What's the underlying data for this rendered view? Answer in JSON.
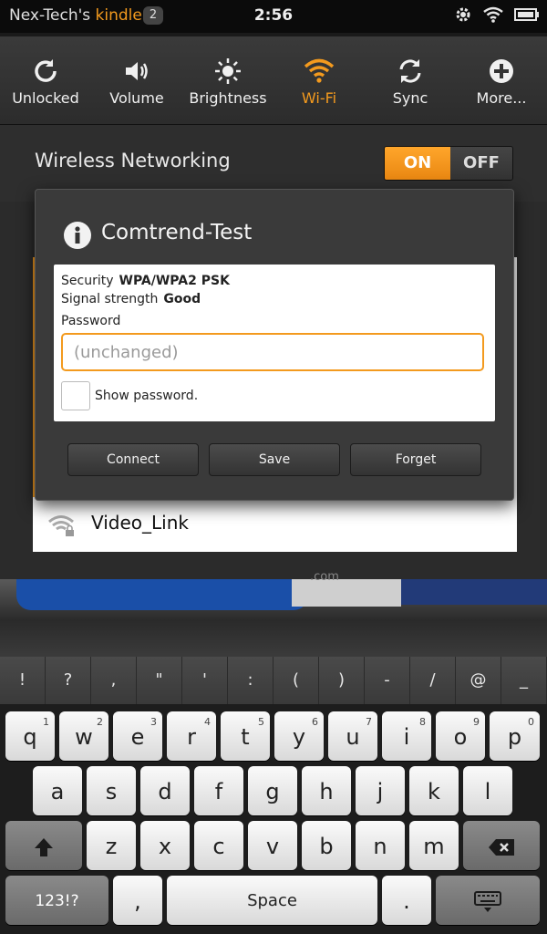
{
  "status": {
    "brand_prefix": "Nex-Tech's ",
    "brand_name": "kindle",
    "notification_count": "2",
    "time": "2:56"
  },
  "quick_settings": [
    {
      "label": "Unlocked",
      "icon": "rotate-lock-icon",
      "active": false
    },
    {
      "label": "Volume",
      "icon": "speaker-icon",
      "active": false
    },
    {
      "label": "Brightness",
      "icon": "sun-icon",
      "active": false
    },
    {
      "label": "Wi-Fi",
      "icon": "wifi-icon",
      "active": true
    },
    {
      "label": "Sync",
      "icon": "sync-icon",
      "active": false
    },
    {
      "label": "More...",
      "icon": "plus-icon",
      "active": false
    }
  ],
  "wireless": {
    "title": "Wireless Networking",
    "on_label": "ON",
    "off_label": "OFF"
  },
  "network_list": {
    "visible_item": "Video_Link"
  },
  "shelf": {
    "book_text": ".com"
  },
  "dialog": {
    "title": "Comtrend-Test",
    "security_label": "Security",
    "security_value": "WPA/WPA2 PSK",
    "signal_label": "Signal strength",
    "signal_value": "Good",
    "password_label": "Password",
    "password_placeholder": "(unchanged)",
    "show_password_label": "Show password.",
    "buttons": {
      "connect": "Connect",
      "save": "Save",
      "forget": "Forget"
    }
  },
  "keyboard": {
    "symbols": [
      "!",
      "?",
      ",",
      "\"",
      "'",
      ":",
      "(",
      ")",
      "-",
      "/",
      "@",
      "_"
    ],
    "row1": [
      {
        "k": "q",
        "n": "1"
      },
      {
        "k": "w",
        "n": "2"
      },
      {
        "k": "e",
        "n": "3"
      },
      {
        "k": "r",
        "n": "4"
      },
      {
        "k": "t",
        "n": "5"
      },
      {
        "k": "y",
        "n": "6"
      },
      {
        "k": "u",
        "n": "7"
      },
      {
        "k": "i",
        "n": "8"
      },
      {
        "k": "o",
        "n": "9"
      },
      {
        "k": "p",
        "n": "0"
      }
    ],
    "row2": [
      "a",
      "s",
      "d",
      "f",
      "g",
      "h",
      "j",
      "k",
      "l"
    ],
    "row3": [
      "z",
      "x",
      "c",
      "v",
      "b",
      "n",
      "m"
    ],
    "num_key": "123!?",
    "comma_key": ",",
    "space_key": "Space",
    "period_key": "."
  },
  "colors": {
    "accent": "#f39a1e"
  }
}
